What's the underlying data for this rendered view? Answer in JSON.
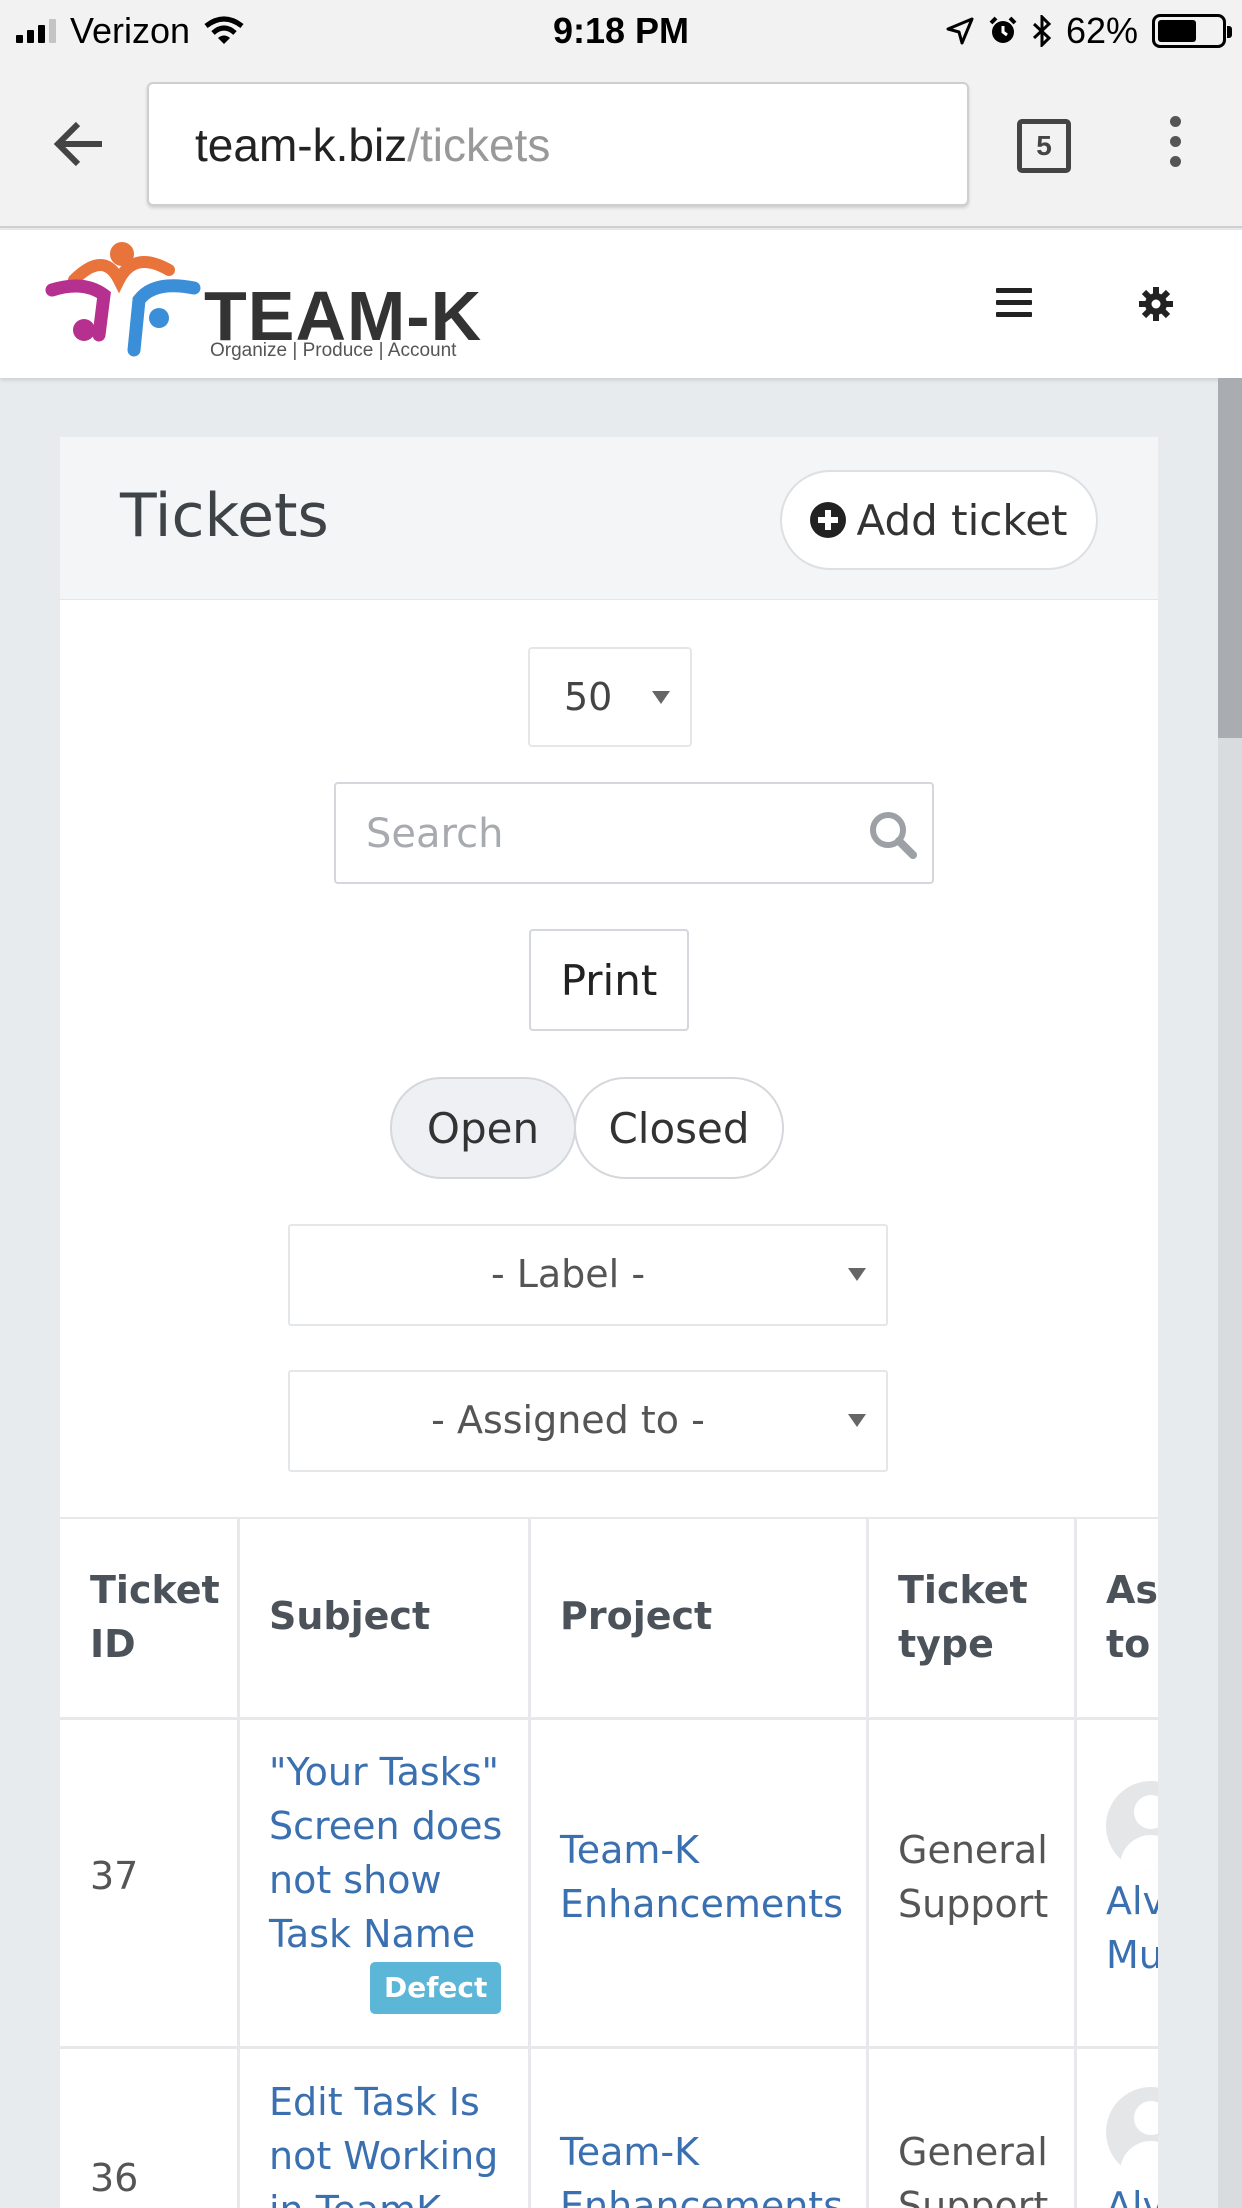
{
  "status_bar": {
    "carrier": "Verizon",
    "time": "9:18 PM",
    "battery_percent": "62%",
    "battery_level": 0.62
  },
  "browser": {
    "url_host": "team-k.biz",
    "url_path": "/tickets",
    "tab_count": "5"
  },
  "brand": {
    "logo_text": "TEAM-K",
    "tagline": "Organize | Produce | Account",
    "colors": {
      "orange": "#e8743b",
      "magenta": "#b5308f",
      "blue": "#3a8fd8"
    }
  },
  "page": {
    "title": "Tickets",
    "add_ticket_label": "Add ticket",
    "page_size": "50",
    "search_placeholder": "Search",
    "print_label": "Print",
    "status_open": "Open",
    "status_closed": "Closed",
    "label_filter": "- Label -",
    "assigned_filter": "- Assigned to -"
  },
  "table": {
    "headers": {
      "id_1": "Ticket",
      "id_2": "ID",
      "subject": "Subject",
      "project": "Project",
      "type_1": "Ticket",
      "type_2": "type",
      "assigned_1": "Ass",
      "assigned_2": "to"
    },
    "rows": [
      {
        "id": "37",
        "subject_lines": [
          "\"Your Tasks\"",
          "Screen does",
          "not show",
          "Task Name"
        ],
        "label": "Defect",
        "project_lines": [
          "Team-K",
          "Enhancements"
        ],
        "type_lines": [
          "General",
          "Support"
        ],
        "assigned_lines": [
          "Alv",
          "Mu"
        ]
      },
      {
        "id": "36",
        "subject_lines": [
          "Edit Task Is",
          "not Working",
          "in TeamK"
        ],
        "project_lines": [
          "Team-K",
          "Enhancements"
        ],
        "type_lines": [
          "General",
          "Support"
        ],
        "assigned_lines": [
          "Alv"
        ]
      }
    ]
  }
}
